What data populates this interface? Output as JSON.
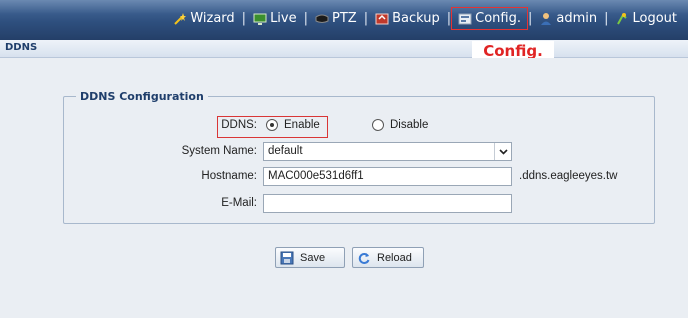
{
  "nav": {
    "wizard": "Wizard",
    "live": "Live",
    "ptz": "PTZ",
    "backup": "Backup",
    "config": "Config.",
    "admin": "admin",
    "logout": "Logout",
    "separator": "|"
  },
  "callout": "Config.",
  "page_title": "DDNS",
  "form": {
    "legend": "DDNS Configuration",
    "ddns_label": "DDNS:",
    "enable_label": "Enable",
    "disable_label": "Disable",
    "ddns_selected": "Enable",
    "system_name_label": "System Name:",
    "system_name_value": "default",
    "hostname_label": "Hostname:",
    "hostname_value": "MAC000e531d6ff1",
    "hostname_suffix": ".ddns.eagleeyes.tw",
    "email_label": "E-Mail:",
    "email_value": ""
  },
  "buttons": {
    "save": "Save",
    "reload": "Reload"
  },
  "colors": {
    "topbar": "#2e4f7e",
    "highlight": "#e02424",
    "content_bg": "#eaeef3"
  }
}
